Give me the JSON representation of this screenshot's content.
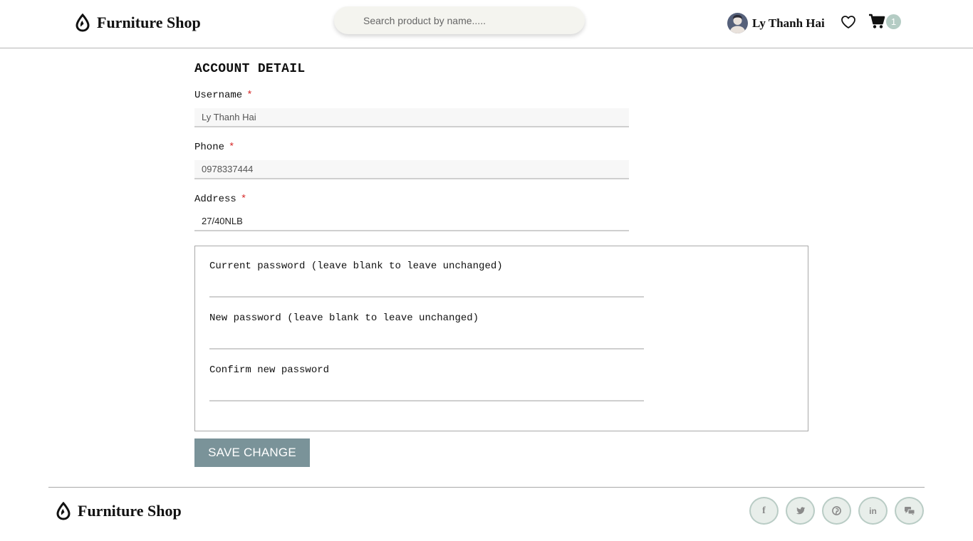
{
  "header": {
    "brand_name": "Furniture Shop",
    "brand_icon": "drop-icon",
    "search_placeholder": "Search product by name.....",
    "user_name": "Ly Thanh Hai",
    "wishlist_icon": "heart-icon",
    "cart_icon": "cart-icon",
    "cart_count": "1",
    "badge_color": "#b4ccc4"
  },
  "form": {
    "title": "ACCOUNT DETAIL",
    "required_mark": "*",
    "fields": [
      {
        "label": "Username",
        "value": "Ly Thanh Hai"
      },
      {
        "label": "Phone",
        "value": "0978337444"
      },
      {
        "label": "Address",
        "value": "27/40NLB"
      }
    ],
    "password": {
      "current_label": "Current password (leave blank to leave unchanged)",
      "new_label": "New password (leave blank to leave unchanged)",
      "confirm_label": "Confirm new password"
    },
    "save_label": "SAVE CHANGE",
    "save_color": "#7a9399"
  },
  "footer": {
    "brand_name": "Furniture Shop",
    "social": [
      {
        "icon": "facebook-icon",
        "glyph": "f"
      },
      {
        "icon": "twitter-icon"
      },
      {
        "icon": "pinterest-icon"
      },
      {
        "icon": "linkedin-icon",
        "glyph": "in"
      },
      {
        "icon": "chat-icon"
      }
    ]
  }
}
